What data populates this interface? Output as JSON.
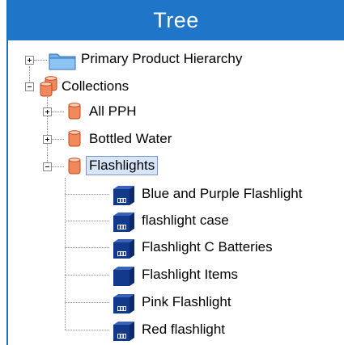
{
  "header": {
    "title": "Tree"
  },
  "tree": {
    "root_items": [
      {
        "label": "Primary Product Hierarchy",
        "icon": "folder-icon",
        "state": "collapsed"
      },
      {
        "label": "Collections",
        "icon": "database-icon",
        "state": "expanded"
      }
    ],
    "collections": [
      {
        "label": "All PPH",
        "icon": "database-icon",
        "state": "collapsed"
      },
      {
        "label": "Bottled Water",
        "icon": "database-icon",
        "state": "collapsed"
      },
      {
        "label": "Flashlights",
        "icon": "database-icon",
        "state": "expanded",
        "selected": true
      }
    ],
    "flashlight_items": [
      {
        "label": "Blue and Purple Flashlight",
        "icon": "item-icon"
      },
      {
        "label": "flashlight case",
        "icon": "item-icon"
      },
      {
        "label": "Flashlight C Batteries",
        "icon": "item-icon"
      },
      {
        "label": "Flashlight Items",
        "icon": "item-group-icon"
      },
      {
        "label": "Pink Flashlight",
        "icon": "item-icon"
      },
      {
        "label": "Red flashlight",
        "icon": "item-icon"
      }
    ]
  },
  "colors": {
    "header_bg": "#1f75c7",
    "header_text": "#ffffff",
    "folder_icon": "#6fb2ec",
    "database_icon": "#f08a5d",
    "item_icon": "#123a8c",
    "selection_bg": "#d6e6f7"
  }
}
